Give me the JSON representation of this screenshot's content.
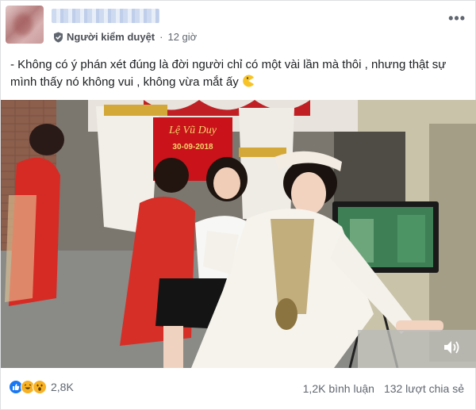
{
  "post": {
    "author_role": "Người kiểm duyệt",
    "separator": "·",
    "time": "12 giờ",
    "text": "- Không có ý phán xét đúng là đời người chỉ có một vài lần mà thôi , nhưng thật sự mình thấy nó không vui , không vừa mắt ấy"
  },
  "video": {
    "banner_name": "Lệ Vũ Duy",
    "banner_date": "30-09-2018",
    "volume_icon": "speaker-icon"
  },
  "footer": {
    "reaction_count": "2,8K",
    "comments": "1,2K bình luận",
    "shares": "132 lượt chia sẻ"
  },
  "colors": {
    "like_blue": "#1877f2",
    "haha_yellow": "#f7b125",
    "text_gray": "#606770"
  }
}
